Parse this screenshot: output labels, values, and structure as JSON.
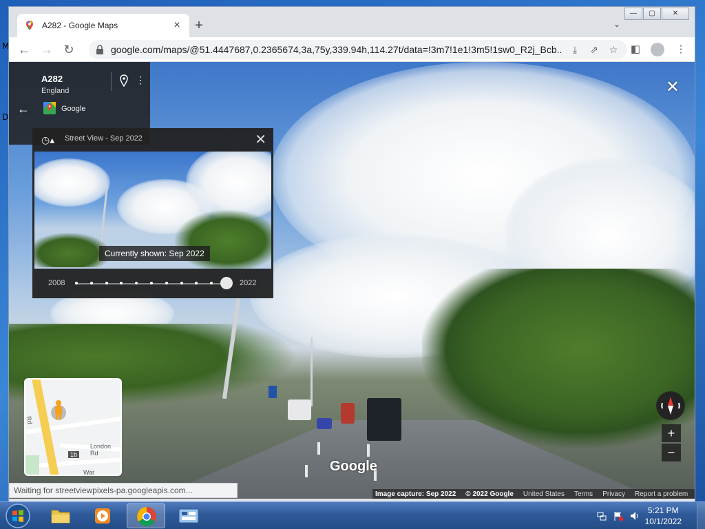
{
  "desktop": {
    "left_letters": [
      "M",
      "D"
    ]
  },
  "browser": {
    "tab": {
      "title": "A282 - Google Maps",
      "close": "×"
    },
    "new_tab": "+",
    "tab_search": "⌄",
    "window_controls": {
      "min": "—",
      "max": "▢",
      "close": "✕"
    },
    "nav": {
      "back": "←",
      "forward": "→",
      "reload": "↻"
    },
    "url": "google.com/maps/@51.4447687,0.2365674,3a,75y,339.94h,114.27t/data=!3m7!1e1!3m5!1sw0_R2j_Bcb...",
    "omni_icons": {
      "install": "⤓",
      "share": "⇗",
      "bookmark": "☆"
    },
    "toolbar_icons": {
      "sidebar": "◧",
      "menu": "⋮"
    }
  },
  "streetview": {
    "exit": "✕",
    "info": {
      "title": "A282",
      "subtitle": "England",
      "source": "Google",
      "back": "←",
      "more": "⋮"
    },
    "timeline": {
      "title": "Street View - Sep 2022",
      "close": "✕",
      "history": "◷▴",
      "current_label": "Currently shown: Sep 2022",
      "start_year": "2008",
      "end_year": "2022",
      "dot_count": 11,
      "selected_fraction": 1.0
    },
    "minimap": {
      "road_label": "London Rd",
      "side_label": "Rd",
      "badge": "1b",
      "bottom_label": "War"
    },
    "zoom": {
      "in": "+",
      "out": "−"
    },
    "watermark": "Google",
    "footer": {
      "capture": "Image capture: Sep 2022",
      "copyright": "© 2022 Google",
      "links": [
        "United States",
        "Terms",
        "Privacy",
        "Report a problem"
      ]
    }
  },
  "status_bar": "Waiting for streetviewpixels-pa.googleapis.com...",
  "taskbar": {
    "clock_time": "5:21 PM",
    "clock_date": "10/1/2022"
  }
}
